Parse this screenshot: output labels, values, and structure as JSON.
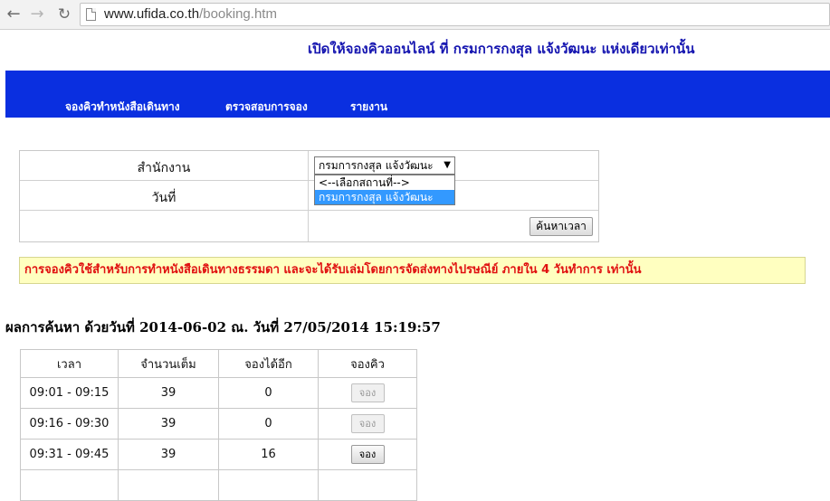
{
  "browser": {
    "url_domain": "www.ufida.co.th",
    "url_path": "/booking.htm"
  },
  "page": {
    "heading": "เปิดให้จองคิวออนไลน์ ที่ กรมการกงสุล แจ้งวัฒนะ แห่งเดียวเท่านั้น",
    "menu": [
      "จองคิวทำหนังสือเดินทาง",
      "ตรวจสอบการจอง",
      "รายงาน"
    ],
    "colors": {
      "menu_bar": "#0a2fe0",
      "heading": "#1515b0",
      "notice_text": "#e01010",
      "notice_bg": "#ffffc0"
    }
  },
  "search": {
    "office_label": "สำนักงาน",
    "date_label": "วันที่",
    "office_selected": "กรมการกงสุล แจ้งวัฒนะ",
    "office_options": [
      "<--เลือกสถานที่-->",
      "กรมการกงสุล แจ้งวัฒนะ"
    ],
    "search_button": "ค้นหาเวลา"
  },
  "notice": "การจองคิวใช้สำหรับการทำหนังสือเดินทางธรรมดา และจะได้รับเล่มโดยการจัดส่งทางไปรษณีย์ ภายใน 4 วันทำการ เท่านั้น",
  "results": {
    "title": "ผลการค้นหา ด้วยวันที่ 2014-06-02 ณ. วันที่ 27/05/2014 15:19:57",
    "columns": [
      "เวลา",
      "จำนวนเต็ม",
      "จองได้อีก",
      "จองคิว"
    ],
    "rows": [
      {
        "time": "09:01 - 09:15",
        "full": "39",
        "available": "0",
        "button": "จอง",
        "enabled": false
      },
      {
        "time": "09:16 - 09:30",
        "full": "39",
        "available": "0",
        "button": "จอง",
        "enabled": false
      },
      {
        "time": "09:31 - 09:45",
        "full": "39",
        "available": "16",
        "button": "จอง",
        "enabled": true
      },
      {
        "time": "",
        "full": "",
        "available": "",
        "button": "",
        "enabled": false
      }
    ]
  }
}
